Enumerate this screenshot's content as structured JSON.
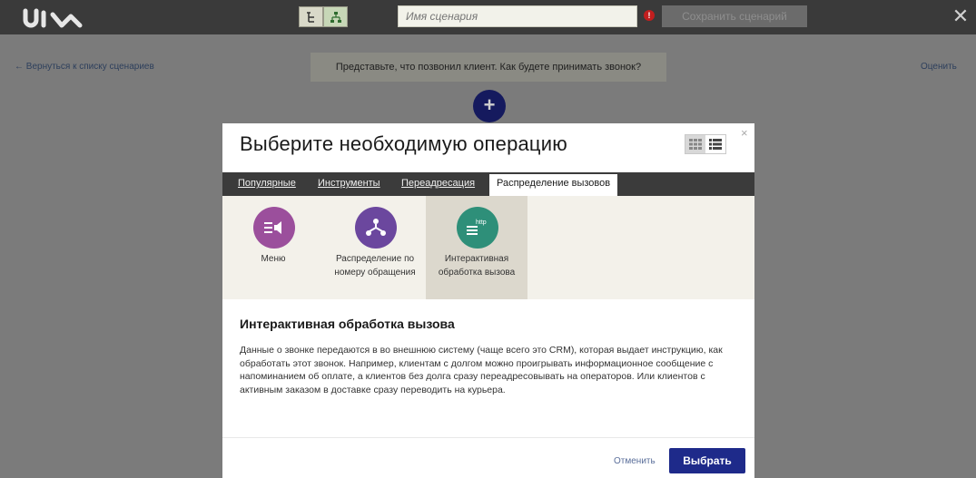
{
  "header": {
    "logo_text": "uis",
    "scenario_placeholder": "Имя сценария",
    "warning_symbol": "!",
    "save_label": "Сохранить сценарий",
    "close_symbol": "✕"
  },
  "page": {
    "back_label": "← Вернуться к списку сценариев",
    "prompt_text": "Представьте, что позвонил клиент. Как будете принимать звонок?",
    "rate_label": "Оценить",
    "add_symbol": "+"
  },
  "modal": {
    "title": "Выберите необходимую операцию",
    "close_symbol": "×",
    "tabs": [
      {
        "label": "Популярные"
      },
      {
        "label": "Инструменты"
      },
      {
        "label": "Переадресация"
      },
      {
        "label": "Распределение вызовов",
        "active": true
      }
    ],
    "operations": [
      {
        "label": "Меню",
        "icon": "menu-megaphone-icon",
        "color": "#9b4f9c"
      },
      {
        "label": "Распределение по номеру обращения",
        "icon": "distribution-icon",
        "color": "#6b479e"
      },
      {
        "label": "Интерактивная обработка вызова",
        "icon": "http-icon",
        "color": "#2e8f79",
        "selected": true
      }
    ],
    "description": {
      "title": "Интерактивная обработка вызова",
      "text": "Данные о звонке передаются в во внешнюю систему (чаще всего это CRM), которая выдает инструкцию, как обработать этот звонок. Например, клиентам с долгом можно проигрывать информационное сообщение с напоминанием об оплате, а клиентов без долга сразу переадресовывать на операторов. Или клиентов с активным заказом в доставке сразу переводить на курьера."
    },
    "cancel_label": "Отменить",
    "choose_label": "Выбрать"
  },
  "colors": {
    "accent": "#1e2a8a",
    "topbar": "#3a3a3a"
  }
}
